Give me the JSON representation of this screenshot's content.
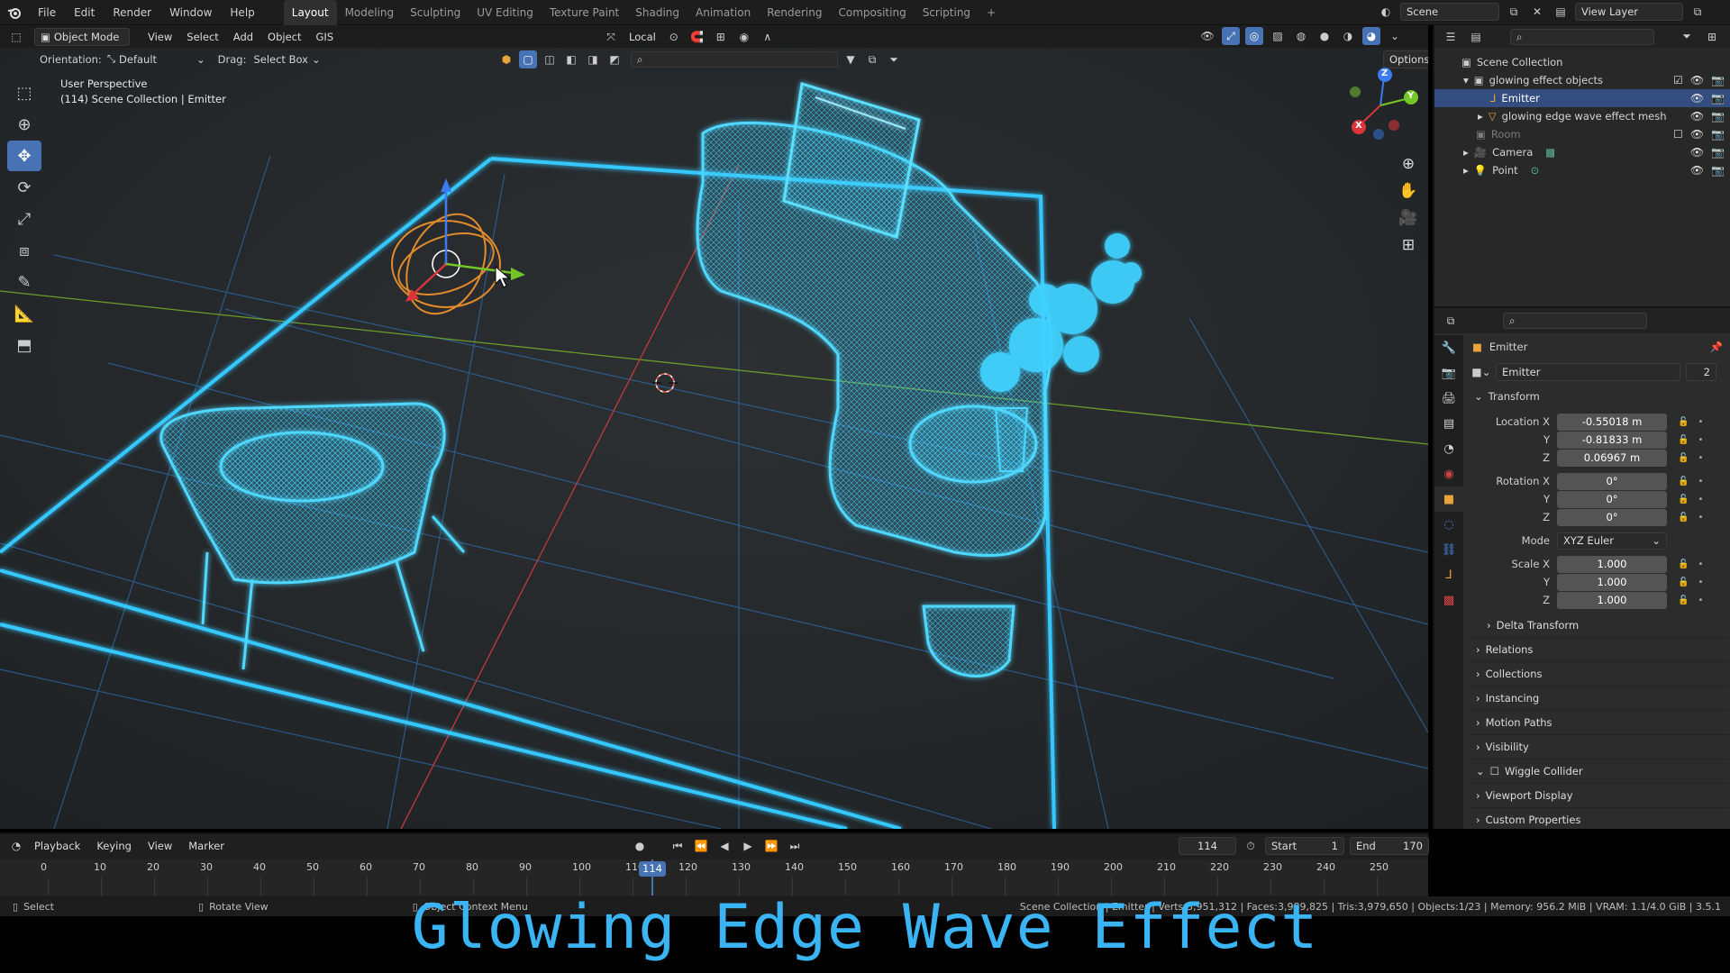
{
  "app": {
    "menu": [
      "File",
      "Edit",
      "Render",
      "Window",
      "Help"
    ],
    "workspaces": [
      "Layout",
      "Modeling",
      "Sculpting",
      "UV Editing",
      "Texture Paint",
      "Shading",
      "Animation",
      "Rendering",
      "Compositing",
      "Scripting"
    ],
    "active_workspace": "Layout",
    "add_workspace": "+",
    "scene": "Scene",
    "view_layer": "View Layer"
  },
  "viewport_header": {
    "mode": "Object Mode",
    "menus": [
      "View",
      "Select",
      "Add",
      "Object",
      "GIS"
    ],
    "transform_space": "Local",
    "orientation_label": "Orientation:",
    "orientation_value": "Default",
    "drag_label": "Drag:",
    "drag_value": "Select Box",
    "options": "Options"
  },
  "viewport": {
    "view_name": "User Perspective",
    "context": "(114) Scene Collection | Emitter",
    "gizmo_axes": [
      "X",
      "Y",
      "Z"
    ]
  },
  "outliner": {
    "root": "Scene Collection",
    "items": [
      {
        "label": "glowing effect objects",
        "depth": 1,
        "expanded": true
      },
      {
        "label": "Emitter",
        "depth": 2,
        "selected": true
      },
      {
        "label": "glowing edge wave effect mesh",
        "depth": 2
      },
      {
        "label": "Room",
        "depth": 1,
        "disabled": true
      },
      {
        "label": "Camera",
        "depth": 1
      },
      {
        "label": "Point",
        "depth": 1
      }
    ]
  },
  "properties": {
    "object_name": "Emitter",
    "datablock_name": "Emitter",
    "users": "2",
    "transform_header": "Transform",
    "location": {
      "label_x": "Location X",
      "x": "-0.55018 m",
      "y": "-0.81833 m",
      "z": "0.06967 m"
    },
    "rotation": {
      "label_x": "Rotation X",
      "x": "0°",
      "y": "0°",
      "z": "0°"
    },
    "mode_label": "Mode",
    "mode_value": "XYZ Euler",
    "scale": {
      "label_x": "Scale X",
      "x": "1.000",
      "y": "1.000",
      "z": "1.000"
    },
    "axis_y": "Y",
    "axis_z": "Z",
    "panels": [
      "Delta Transform",
      "Relations",
      "Collections",
      "Instancing",
      "Motion Paths",
      "Visibility",
      "Wiggle Collider",
      "Viewport Display",
      "Custom Properties"
    ]
  },
  "timeline": {
    "menus": [
      "Playback",
      "Keying",
      "View",
      "Marker"
    ],
    "current_frame": "114",
    "start_label": "Start",
    "start": "1",
    "end_label": "End",
    "end": "170",
    "ticks": [
      "0",
      "10",
      "20",
      "30",
      "40",
      "50",
      "60",
      "70",
      "80",
      "90",
      "100",
      "110",
      "120",
      "130",
      "140",
      "150",
      "160",
      "170",
      "180",
      "190",
      "200",
      "210",
      "220",
      "230",
      "240",
      "250"
    ],
    "playhead": "114"
  },
  "statusbar": {
    "select": "Select",
    "rotate": "Rotate View",
    "context_menu": "Object Context Menu",
    "stats": "Scene Collection | Emitter | Verts:3,951,312 | Faces:3,989,825 | Tris:3,979,650 | Objects:1/23 | Memory: 956.2 MiB | VRAM: 1.1/4.0 GiB | 3.5.1"
  },
  "overlay": {
    "title": "Glowing Edge Wave Effect"
  },
  "colors": {
    "glow": "#35c8ff",
    "accent": "#4772b3",
    "overlay_title": "#3ab4f2"
  }
}
